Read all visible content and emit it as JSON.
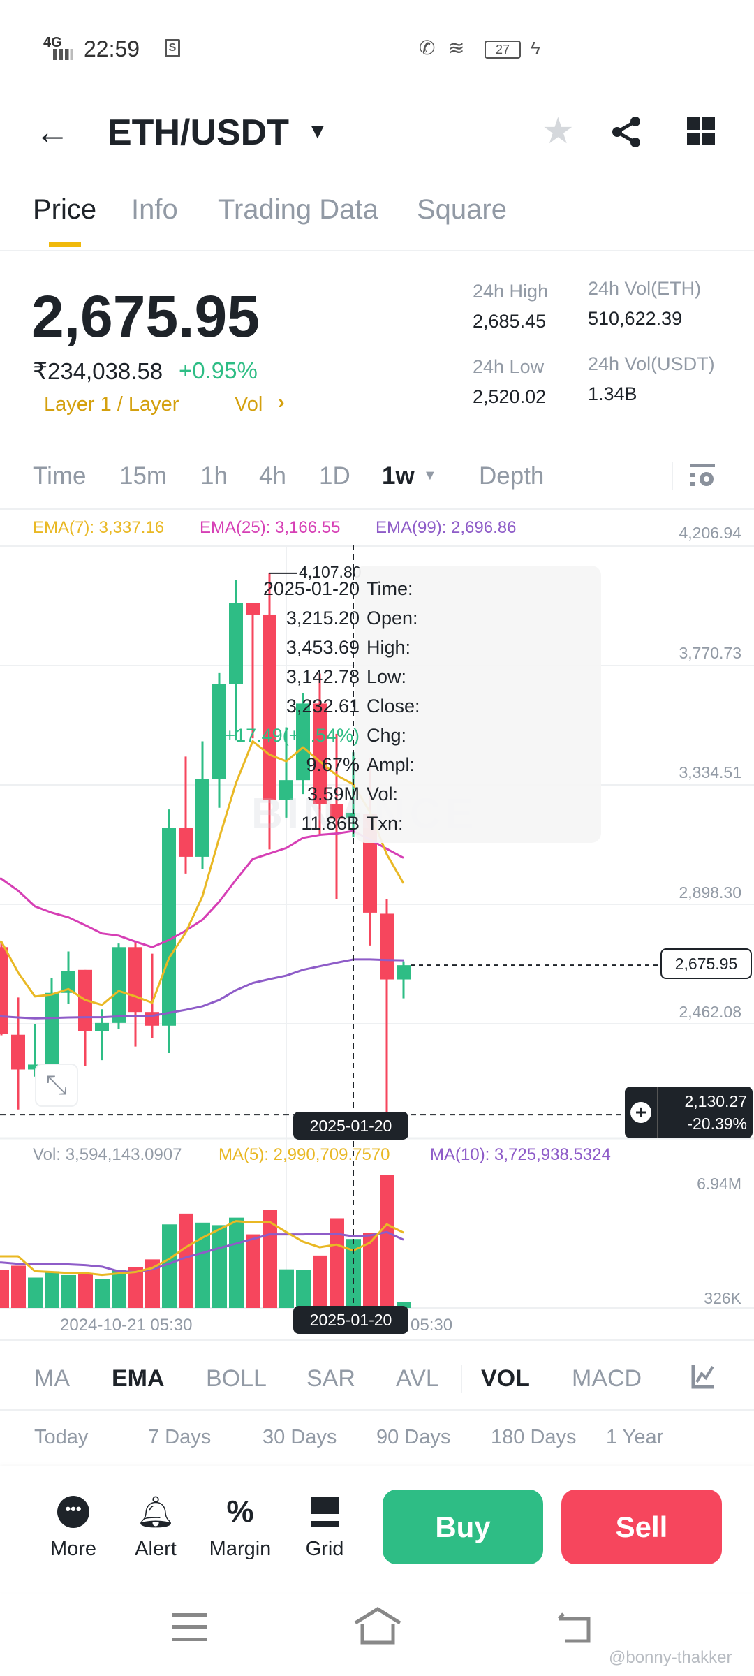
{
  "status_bar": {
    "network": "4G",
    "time": "22:59",
    "battery": "27"
  },
  "header": {
    "pair": "ETH/USDT"
  },
  "tabs": [
    {
      "label": "Price"
    },
    {
      "label": "Info"
    },
    {
      "label": "Trading Data"
    },
    {
      "label": "Square"
    }
  ],
  "ticker": {
    "last_price": "2,675.95",
    "fiat_price": "₹234,038.58",
    "change_pct": "+0.95%",
    "tag": "Layer 1 / Layer",
    "vol_link": "Vol",
    "stats": [
      {
        "label": "24h High",
        "value": "2,685.45"
      },
      {
        "label": "24h Vol(ETH)",
        "value": "510,622.39"
      },
      {
        "label": "24h Low",
        "value": "2,520.02"
      },
      {
        "label": "24h Vol(USDT)",
        "value": "1.34B"
      }
    ]
  },
  "intervals": [
    {
      "label": "Time"
    },
    {
      "label": "15m"
    },
    {
      "label": "1h"
    },
    {
      "label": "4h"
    },
    {
      "label": "1D"
    },
    {
      "label": "1w"
    },
    {
      "label": "Depth"
    }
  ],
  "ema_legend": {
    "ema7": "EMA(7): 3,337.16",
    "ema25": "EMA(25): 3,166.55",
    "ema99": "EMA(99): 2,696.86"
  },
  "vol_legend": {
    "vol": "Vol: 3,594,143.0907",
    "ma5": "MA(5): 2,990,709.7570",
    "ma10": "MA(10): 3,725,938.5324"
  },
  "tooltip": {
    "rows": [
      {
        "label": "Time:",
        "value": "2025-01-20"
      },
      {
        "label": "Open:",
        "value": "3,215.20"
      },
      {
        "label": "High:",
        "value": "3,453.69"
      },
      {
        "label": "Low:",
        "value": "3,142.78"
      },
      {
        "label": "Close:",
        "value": "3,232.61"
      },
      {
        "label": "Chg:",
        "value": "+17.49(+0.54%)"
      },
      {
        "label": "Ampl:",
        "value": "9.67%"
      },
      {
        "label": "Vol:",
        "value": "3.59M"
      },
      {
        "label": "Txn:",
        "value": "11.86B"
      }
    ]
  },
  "watermark": "BINANCE",
  "crosshair": {
    "date": "2025-01-20",
    "price": "2,130.27",
    "pct": "-20.39%"
  },
  "current_price_label": "2,675.95",
  "high_marker": "4,107.80",
  "time_axis": [
    "2024-10-21 05:30",
    "05:30"
  ],
  "indicators": [
    {
      "label": "MA"
    },
    {
      "label": "EMA"
    },
    {
      "label": "BOLL"
    },
    {
      "label": "SAR"
    },
    {
      "label": "AVL"
    },
    {
      "label": "VOL"
    },
    {
      "label": "MACD"
    }
  ],
  "performance": [
    {
      "label": "Today"
    },
    {
      "label": "7 Days"
    },
    {
      "label": "30 Days"
    },
    {
      "label": "90 Days"
    },
    {
      "label": "180 Days"
    },
    {
      "label": "1 Year"
    }
  ],
  "bottom_actions": [
    {
      "label": "More"
    },
    {
      "label": "Alert"
    },
    {
      "label": "Margin"
    },
    {
      "label": "Grid"
    }
  ],
  "buy_label": "Buy",
  "sell_label": "Sell",
  "credit": "@bonny-thakker",
  "colors": {
    "up": "#2EBD85",
    "down": "#F6465D",
    "ema7": "#E9B824",
    "ema25": "#D63FB5",
    "ema99": "#8E5CC8",
    "accent": "#F0B90B"
  },
  "chart_data": {
    "type": "candlestick",
    "interval": "1w",
    "y_ticks": [
      "4,206.94",
      "3,770.73",
      "3,334.51",
      "2,898.30",
      "2,462.08"
    ],
    "y_tick_values": [
      4206.94,
      3770.73,
      3334.51,
      2898.3,
      2462.08
    ],
    "vol_ticks": [
      "6.94M",
      "326K"
    ],
    "candles": [
      {
        "o": 2742,
        "h": 2760,
        "l": 2420,
        "c": 2425,
        "v": 1.97
      },
      {
        "o": 2422,
        "h": 2558,
        "l": 2149,
        "c": 2295,
        "v": 2.2
      },
      {
        "o": 2295,
        "h": 2462,
        "l": 2269,
        "c": 2313,
        "v": 1.58
      },
      {
        "o": 2313,
        "h": 2629,
        "l": 2313,
        "c": 2575,
        "v": 1.91
      },
      {
        "o": 2575,
        "h": 2726,
        "l": 2535,
        "c": 2655,
        "v": 1.71
      },
      {
        "o": 2659,
        "h": 2659,
        "l": 2309,
        "c": 2435,
        "v": 1.82
      },
      {
        "o": 2435,
        "h": 2515,
        "l": 2329,
        "c": 2465,
        "v": 1.49
      },
      {
        "o": 2465,
        "h": 2755,
        "l": 2442,
        "c": 2742,
        "v": 1.97
      },
      {
        "o": 2742,
        "h": 2766,
        "l": 2379,
        "c": 2505,
        "v": 2.14
      },
      {
        "o": 2505,
        "h": 2718,
        "l": 2409,
        "c": 2455,
        "v": 2.53
      },
      {
        "o": 2455,
        "h": 3245,
        "l": 2355,
        "c": 3177,
        "v": 4.35
      },
      {
        "o": 3177,
        "h": 3438,
        "l": 3011,
        "c": 3072,
        "v": 4.91
      },
      {
        "o": 3072,
        "h": 3494,
        "l": 3028,
        "c": 3357,
        "v": 4.44
      },
      {
        "o": 3357,
        "h": 3743,
        "l": 3251,
        "c": 3703,
        "v": 4.31
      },
      {
        "o": 3703,
        "h": 4084,
        "l": 3497,
        "c": 4000,
        "v": 4.7
      },
      {
        "o": 4000,
        "h": 4000,
        "l": 3505,
        "c": 3957,
        "v": 3.83
      },
      {
        "o": 3957,
        "h": 4107.8,
        "l": 3099,
        "c": 3279,
        "v": 5.11
      },
      {
        "o": 3279,
        "h": 3545,
        "l": 3215,
        "c": 3352,
        "v": 2.01
      },
      {
        "o": 3352,
        "h": 3671,
        "l": 3301,
        "c": 3632,
        "v": 1.97
      },
      {
        "o": 3632,
        "h": 3741,
        "l": 3155,
        "c": 3264,
        "v": 2.73
      },
      {
        "o": 3264,
        "h": 3521,
        "l": 2917,
        "c": 3211,
        "v": 4.67
      },
      {
        "o": 3215.2,
        "h": 3453.69,
        "l": 3142.78,
        "c": 3232.61,
        "v": 3.59
      },
      {
        "o": 3228,
        "h": 3434,
        "l": 2748,
        "c": 2868,
        "v": 3.92
      },
      {
        "o": 2864,
        "h": 2917,
        "l": 2125,
        "c": 2624,
        "v": 6.94
      },
      {
        "o": 2624,
        "h": 2690,
        "l": 2555,
        "c": 2675.95,
        "v": 0.326
      }
    ],
    "ema7": [
      2762,
      2649,
      2562,
      2569,
      2589,
      2549,
      2531,
      2582,
      2562,
      2539,
      2702,
      2795,
      2928,
      3141,
      3341,
      3494,
      3445,
      3421,
      3472,
      3421,
      3370,
      3337,
      3235,
      3081,
      2975
    ],
    "ema25": [
      2992,
      2948,
      2891,
      2868,
      2851,
      2822,
      2792,
      2784,
      2762,
      2742,
      2768,
      2802,
      2842,
      2908,
      2988,
      3064,
      3084,
      3104,
      3141,
      3152,
      3157,
      3166,
      3135,
      3101,
      3068
    ],
    "ema99": [
      2489,
      2485,
      2482,
      2483,
      2485,
      2486,
      2486,
      2489,
      2490,
      2491,
      2502,
      2513,
      2526,
      2549,
      2585,
      2611,
      2625,
      2638,
      2659,
      2672,
      2685,
      2697,
      2697,
      2695,
      2694
    ],
    "vol_ma5": [
      2.69,
      2.69,
      1.91,
      1.87,
      1.82,
      1.82,
      1.72,
      1.8,
      1.87,
      2.08,
      2.54,
      3.16,
      3.66,
      4.09,
      4.52,
      4.45,
      4.48,
      3.95,
      3.45,
      3.16,
      3.3,
      2.99,
      3.4,
      4.35,
      3.92
    ],
    "vol_ma10": [
      2.37,
      2.3,
      2.28,
      2.28,
      2.27,
      2.23,
      2.15,
      1.91,
      1.87,
      2.01,
      2.3,
      2.63,
      2.87,
      3.12,
      3.35,
      3.59,
      3.83,
      3.83,
      3.83,
      3.86,
      3.86,
      3.73,
      3.78,
      3.95,
      3.55
    ],
    "volume_unit": "M",
    "current_price": 2675.95,
    "crosshair_price": 2130.27,
    "selected_index": 21
  }
}
